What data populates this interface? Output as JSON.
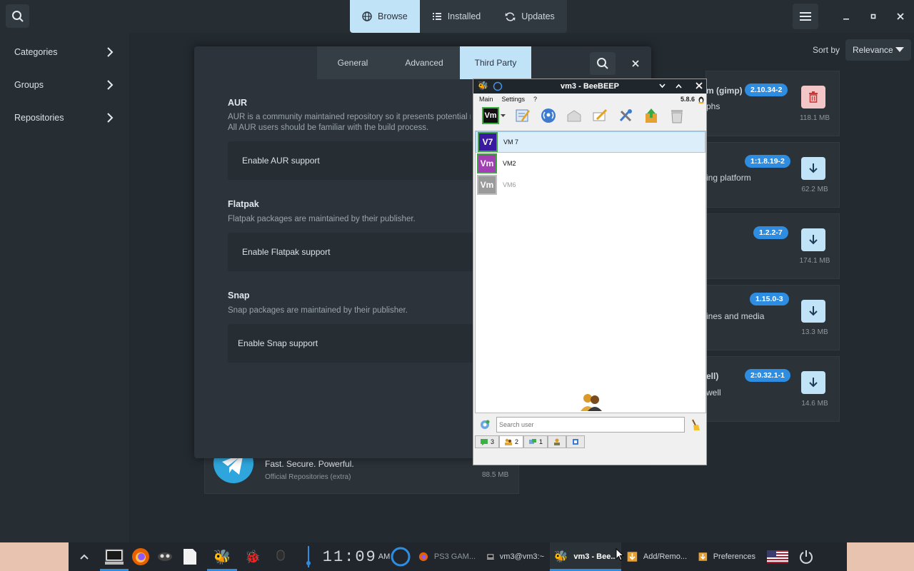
{
  "top": {
    "views": [
      {
        "label": "Browse",
        "icon": "globe-icon",
        "active": true
      },
      {
        "label": "Installed",
        "icon": "list-icon",
        "active": false
      },
      {
        "label": "Updates",
        "icon": "refresh-icon",
        "active": false
      }
    ]
  },
  "sidebar": {
    "items": [
      {
        "label": "Categories"
      },
      {
        "label": "Groups"
      },
      {
        "label": "Repositories"
      }
    ]
  },
  "sort": {
    "label": "Sort by",
    "value": "Relevance"
  },
  "packages": [
    {
      "name_fragment": "m (gimp)",
      "desc_fragment": "phs",
      "version": "2.10.34-2",
      "size": "118.1 MB",
      "action": "remove"
    },
    {
      "name_fragment": "",
      "desc_fragment": "ing platform",
      "version": "1:1.8.19-2",
      "size": "62.2 MB",
      "action": "install"
    },
    {
      "name_fragment": "",
      "desc_fragment": "",
      "version": "1.2.2-7",
      "size": "174.1 MB",
      "action": "install"
    },
    {
      "name_fragment": "",
      "desc_fragment": "ines and media",
      "version": "1.15.0-3",
      "size": "13.3 MB",
      "action": "install"
    },
    {
      "name_fragment": "ell)",
      "desc_fragment": "well",
      "version": "2:0.32.1-1",
      "size": "14.6 MB",
      "action": "install"
    }
  ],
  "telegram": {
    "tagline": "Fast. Secure. Powerful.",
    "repo": "Official Repositories (extra)",
    "size": "88.5 MB"
  },
  "dialog": {
    "tabs": [
      {
        "label": "General",
        "active": false
      },
      {
        "label": "Advanced",
        "active": false
      },
      {
        "label": "Third Party",
        "active": true
      }
    ],
    "sections": [
      {
        "title": "AUR",
        "desc1": "AUR is a community maintained repository so it presents potential ri",
        "desc2": "All AUR users should be familiar with the build process.",
        "option": "Enable AUR support"
      },
      {
        "title": "Flatpak",
        "desc1": "Flatpak packages are maintained by their publisher.",
        "desc2": "",
        "option": "Enable Flatpak support"
      },
      {
        "title": "Snap",
        "desc1": "Snap packages are maintained by their publisher.",
        "desc2": "",
        "option": "Enable Snap support"
      }
    ]
  },
  "beebeep": {
    "title": "vm3 - BeeBEEP",
    "menu": [
      "Main",
      "Settings",
      "?"
    ],
    "version": "5.8.6",
    "users": [
      {
        "badge": "V7",
        "name": "VM 7",
        "color": "#3a1aa0",
        "selected": true,
        "offline": false
      },
      {
        "badge": "Vm",
        "name": "VM2",
        "color": "#a33fb5",
        "selected": false,
        "offline": false
      },
      {
        "badge": "Vm",
        "name": "VM6",
        "color": "#9a9a9a",
        "selected": false,
        "offline": true
      }
    ],
    "search_placeholder": "Search user",
    "tabs": [
      {
        "label": "3",
        "icon": "chat-icon"
      },
      {
        "label": "2",
        "icon": "users-icon"
      },
      {
        "label": "1",
        "icon": "groups-icon"
      },
      {
        "label": "",
        "icon": "network-icon"
      },
      {
        "label": "",
        "icon": "files-icon"
      }
    ]
  },
  "taskbar": {
    "clock": "11:09",
    "ampm": "AM",
    "tasks": [
      {
        "label": "PS3 GAM...",
        "icon": "firefox-icon"
      },
      {
        "label": "vm3@vm3:~",
        "icon": "terminal-icon"
      },
      {
        "label": "vm3 - Bee...",
        "icon": "bee-icon",
        "active": true
      },
      {
        "label": "Add/Remo...",
        "icon": "download-icon"
      },
      {
        "label": "Preferences",
        "icon": "download-icon"
      }
    ]
  }
}
